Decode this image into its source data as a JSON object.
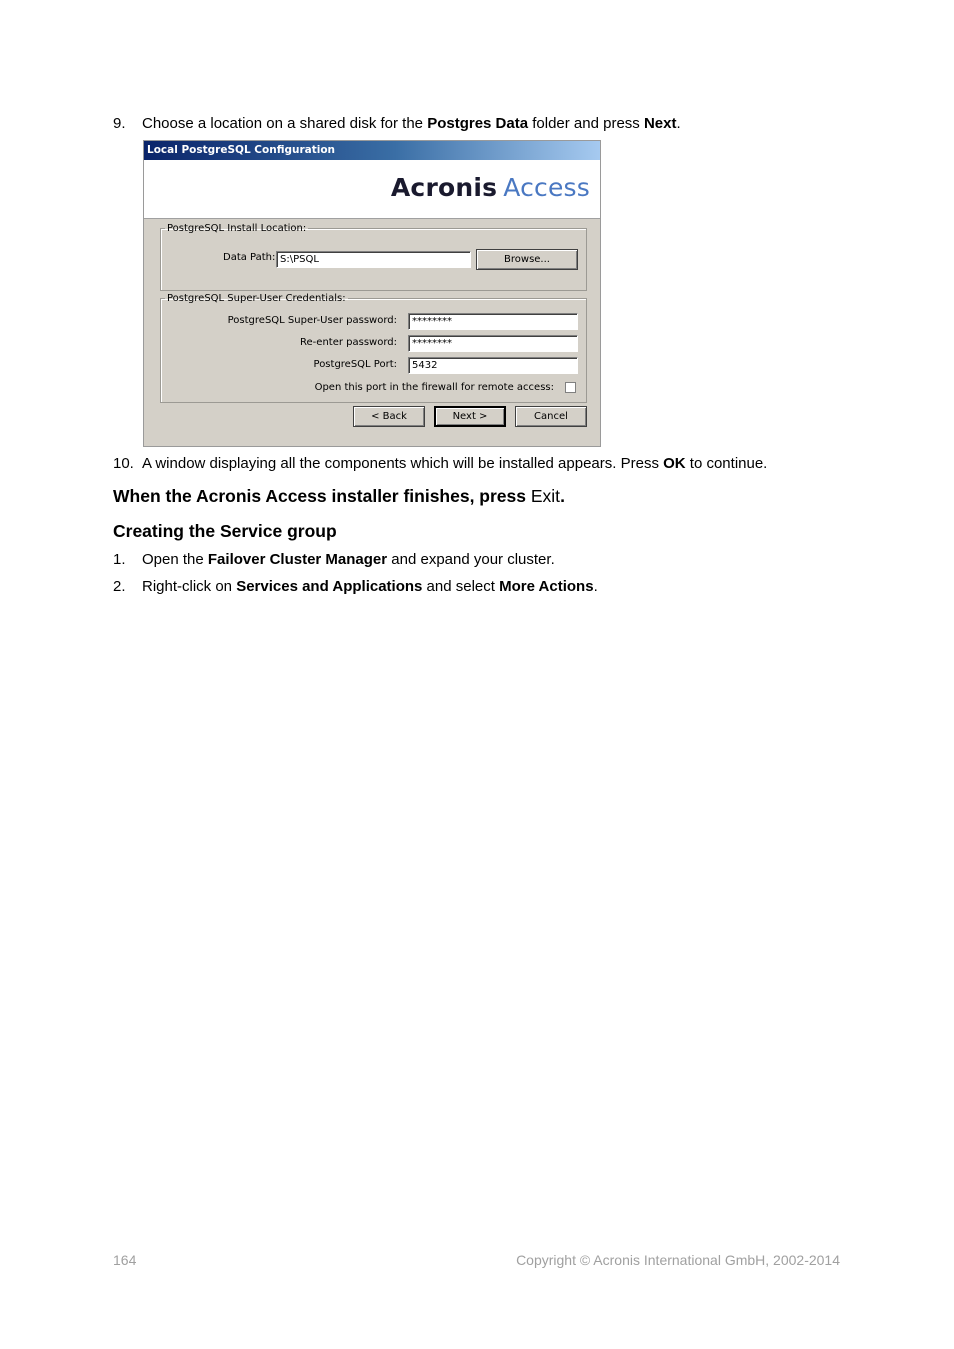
{
  "step9": {
    "number": "9.",
    "text_1": "Choose a location on a shared disk for the ",
    "bold_1": "Postgres Data",
    "text_2": " folder and press ",
    "bold_2": "Next",
    "text_3": "."
  },
  "dialog": {
    "title": "Local PostgreSQL Configuration",
    "logo_word1": "Acronis",
    "logo_word2": "Access",
    "install_group": {
      "legend": "PostgreSQL Install Location:",
      "data_path_label": "Data Path:",
      "data_path_value": "S:\\PSQL",
      "browse_label": "Browse..."
    },
    "credentials_group": {
      "legend": "PostgreSQL Super-User Credentials:",
      "password_label": "PostgreSQL Super-User password:",
      "password_value": "********",
      "reenter_label": "Re-enter password:",
      "reenter_value": "********",
      "port_label": "PostgreSQL Port:",
      "port_value": "5432",
      "firewall_label": "Open this port in the firewall for remote access:",
      "firewall_checked": false
    },
    "buttons": {
      "back": "< Back",
      "next": "Next >",
      "cancel": "Cancel"
    }
  },
  "step10": {
    "number": "10.",
    "text_1": "A window displaying all the components which will be installed appears. Press ",
    "bold_1": "OK",
    "text_2": " to continue."
  },
  "finish_heading": {
    "bold": "When the Acronis Access installer finishes, press ",
    "plain": "Exit",
    "end": "."
  },
  "section_heading": "Creating the Service group",
  "list": [
    {
      "number": "1.",
      "text_1": "Open the ",
      "bold_1": "Failover Cluster Manager",
      "text_2": " and expand your cluster.",
      "bold_2": "",
      "text_3": ""
    },
    {
      "number": "2.",
      "text_1": "Right-click on ",
      "bold_1": "Services and Applications",
      "text_2": " and select ",
      "bold_2": "More Actions",
      "text_3": "."
    }
  ],
  "footer": {
    "page_number": "164",
    "copyright": "Copyright © Acronis International GmbH, 2002-2014"
  }
}
